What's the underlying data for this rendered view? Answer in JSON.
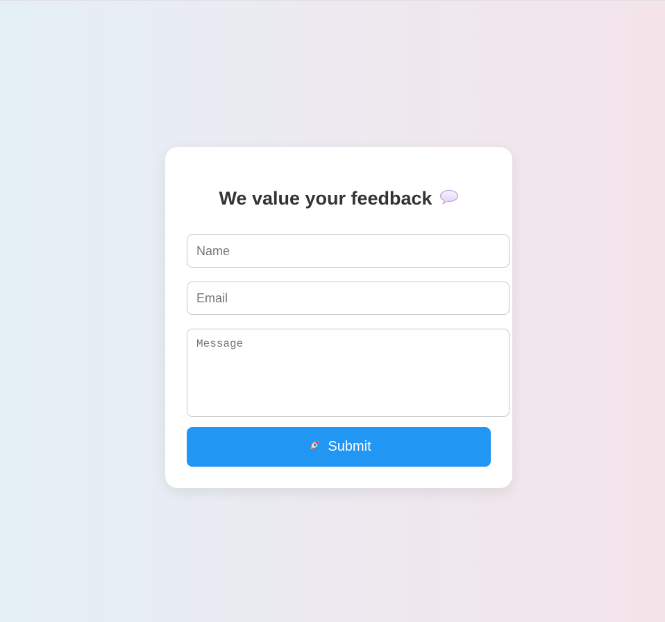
{
  "form": {
    "title": "We value your feedback",
    "title_icon": "speech-bubble-icon",
    "name_placeholder": "Name",
    "email_placeholder": "Email",
    "message_placeholder": "Message",
    "submit_label": "Submit",
    "submit_icon": "rocket-icon"
  },
  "colors": {
    "button": "#2196f3",
    "card": "#ffffff",
    "title_text": "#333333",
    "background_left": "#e4f0f6",
    "background_right": "#f4e4ea"
  }
}
